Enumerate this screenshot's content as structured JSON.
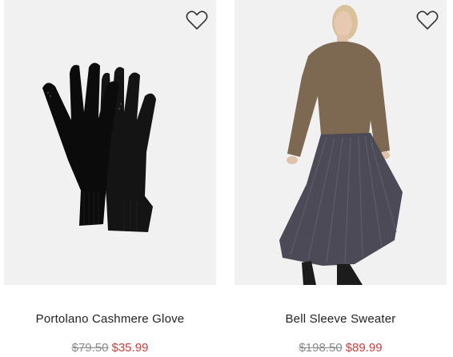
{
  "products": [
    {
      "name": "Portolano Cashmere Glove",
      "original_price": "$79.50",
      "sale_price": "$35.99",
      "image_icon": "gloves-photo",
      "wishlist_icon": "heart-outline-icon"
    },
    {
      "name": "Bell Sleeve Sweater",
      "original_price": "$198.50",
      "sale_price": "$89.99",
      "image_icon": "model-photo",
      "wishlist_icon": "heart-outline-icon"
    }
  ],
  "colors": {
    "sale": "#d33a3a",
    "strikethrough": "#8a8a8a",
    "photo_bg": "#f1f1f1"
  }
}
